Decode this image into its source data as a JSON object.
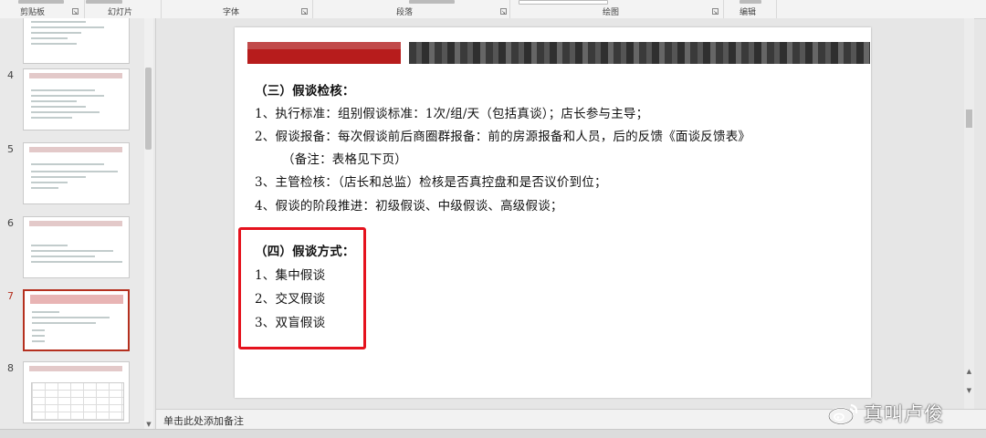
{
  "ribbon": {
    "groups": [
      {
        "label": "剪贴板"
      },
      {
        "label": "幻灯片"
      },
      {
        "label": "字体"
      },
      {
        "label": "段落"
      },
      {
        "label": "绘图"
      },
      {
        "label": "编辑"
      }
    ]
  },
  "thumbnails": {
    "items": [
      {
        "number": "4"
      },
      {
        "number": "5"
      },
      {
        "number": "6"
      },
      {
        "number": "7",
        "selected": true
      },
      {
        "number": "8"
      }
    ]
  },
  "slide": {
    "lines": [
      "（三）假谈检核：",
      "1、执行标准：组别假谈标准：1次/组/天（包括真谈）；店长参与主导；",
      "2、假谈报备：每次假谈前后商圈群报备：前的房源报备和人员，后的反馈《面谈反馈表》",
      "（备注：表格见下页）",
      "3、主管检核：（店长和总监）检核是否真控盘和是否议价到位；",
      "4、假谈的阶段推进：初级假谈、中级假谈、高级假谈；",
      "（四）假谈方式：",
      "1、集中假谈",
      "2、交叉假谈",
      "3、双盲假谈"
    ]
  },
  "notes": {
    "placeholder": "单击此处添加备注"
  },
  "watermark": {
    "text": "真叫卢俊"
  },
  "colors": {
    "highlight_box": "#e5121d",
    "selected_thumb": "#b5301f",
    "banner_red": "#b71c1c"
  }
}
